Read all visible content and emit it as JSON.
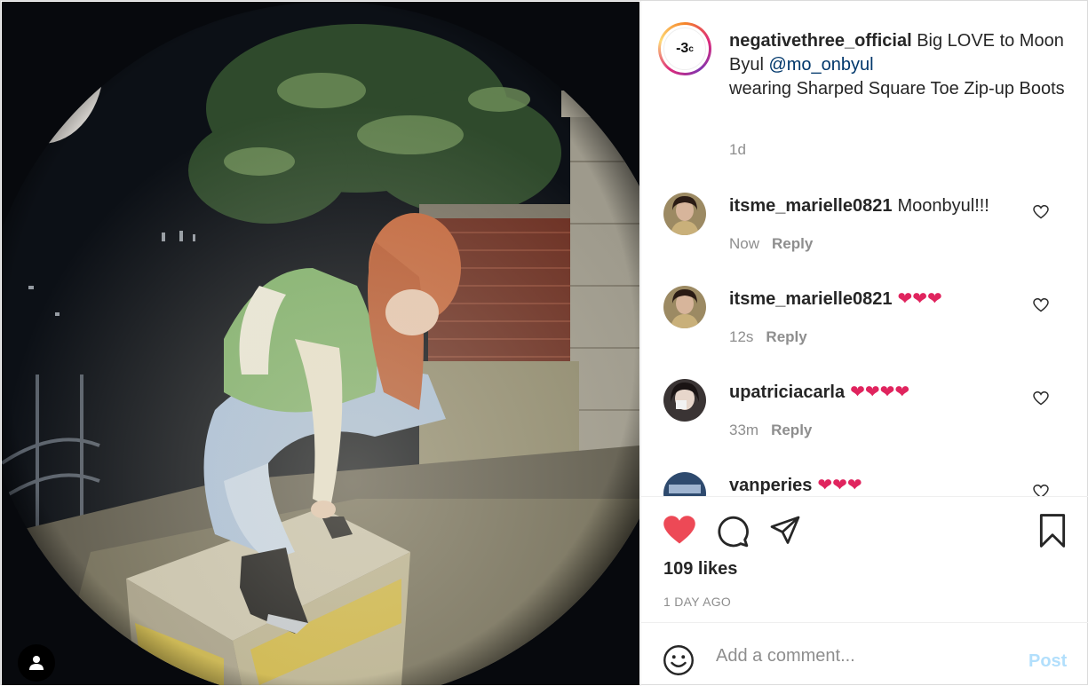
{
  "post": {
    "author": "negativethree_official",
    "brand_mark": "-3",
    "brand_mark_unit": "c",
    "caption_lead": "Big LOVE to Moon Byul",
    "caption_mention": "@mo_onbyul",
    "caption_tail": "wearing Sharped Square Toe Zip-up Boots",
    "time": "1d"
  },
  "comments": [
    {
      "user": "itsme_marielle0821",
      "text": "Moonbyul!!!",
      "time": "Now",
      "reply": "Reply",
      "avatar_icon": "avatar-photo"
    },
    {
      "user": "itsme_marielle0821",
      "text": "❤❤❤",
      "time": "12s",
      "reply": "Reply",
      "avatar_icon": "avatar-photo"
    },
    {
      "user": "upatriciacarla",
      "text": "❤❤❤❤",
      "time": "33m",
      "reply": "Reply",
      "avatar_icon": "avatar-photo"
    },
    {
      "user": "vanperies",
      "text": "❤❤❤",
      "time": "",
      "reply": "",
      "avatar_icon": "avatar-photo"
    }
  ],
  "actions": {
    "likes": "109 likes",
    "date": "1 DAY AGO",
    "liked": true,
    "like_color": "#ed4956"
  },
  "composer": {
    "placeholder": "Add a comment...",
    "post_label": "Post"
  }
}
